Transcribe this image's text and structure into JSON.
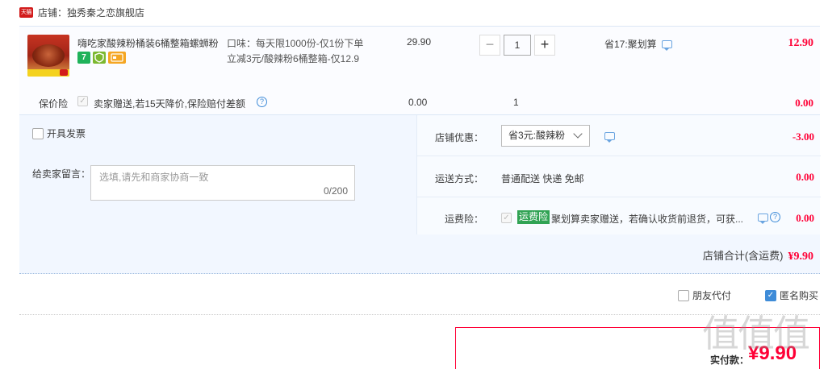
{
  "shop": {
    "badge": "天猫",
    "name": "店铺：独秀秦之恋旗舰店"
  },
  "item": {
    "title": "嗨吃家酸辣粉桶装6桶整箱螺蛳粉",
    "spec_line1": "口味：每天限1000份-仅1份下单",
    "spec_line2": "立减3元/酸辣粉6桶整箱-仅12.9",
    "unit_price": "29.90",
    "quantity": "1",
    "minus": "−",
    "plus": "+",
    "promo": "省17:聚划算",
    "line_total": "12.90",
    "badge_7": "7"
  },
  "insurance": {
    "label": "保价险",
    "text": "卖家赠送,若15天降价,保险赔付差额",
    "price": "0.00",
    "qty": "1",
    "total": "0.00"
  },
  "invoice": {
    "label": "开具发票"
  },
  "message": {
    "label": "给卖家留言：",
    "placeholder": "选填,请先和商家协商一致",
    "count": "0/200"
  },
  "shop_discount": {
    "label": "店铺优惠：",
    "selected": "省3元:酸辣粉",
    "amount": "-3.00"
  },
  "shipping": {
    "label": "运送方式：",
    "value": "普通配送 快递 免邮",
    "amount": "0.00"
  },
  "freight_insurance": {
    "label": "运费险：",
    "badge": "运费险",
    "text": "聚划算卖家赠送，若确认收货前退货，可获...",
    "amount": "0.00"
  },
  "subtotal": {
    "label": "店铺合计(含运费)",
    "amount": "¥9.90"
  },
  "options": {
    "friend_pay": "朋友代付",
    "anonymous": "匿名购买"
  },
  "payment": {
    "label": "实付款：",
    "amount": "¥9.90"
  },
  "watermark": "值值值",
  "colors": {
    "price_red": "#ff0036",
    "accent_blue": "#3f8cd8",
    "panel_bg": "#f2f7ff",
    "insurance_green": "#31a354"
  }
}
